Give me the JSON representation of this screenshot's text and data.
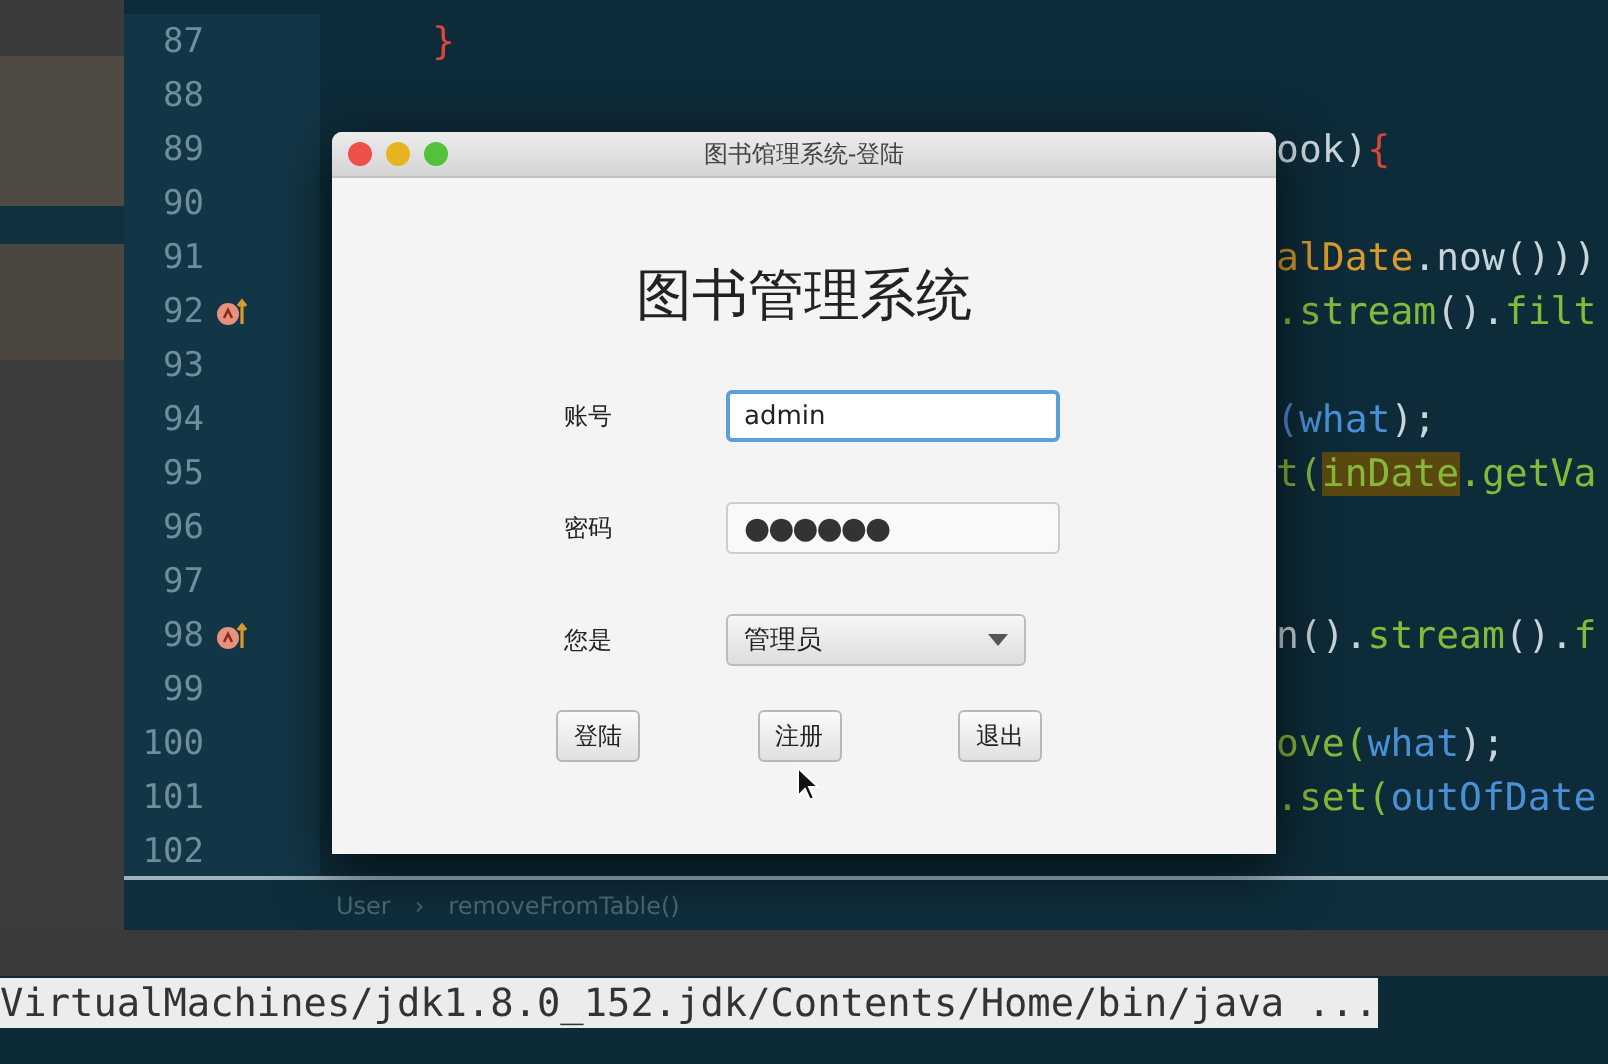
{
  "editor": {
    "lines": [
      {
        "number": "87",
        "marker": false,
        "kind": "full",
        "tokens": [
          {
            "text": "}",
            "color": "#d8463c",
            "highlighted": false
          }
        ]
      },
      {
        "number": "88",
        "marker": false,
        "kind": "tail"
      },
      {
        "number": "89",
        "marker": false,
        "kind": "tail",
        "tokens": [
          {
            "text": "ook)",
            "color": "#c9d4da",
            "highlighted": false
          },
          {
            "text": "{",
            "color": "#d8463c",
            "highlighted": false
          }
        ]
      },
      {
        "number": "90",
        "marker": false,
        "kind": "tail"
      },
      {
        "number": "91",
        "marker": false,
        "kind": "tail",
        "tokens": [
          {
            "text": "alDate",
            "color": "#d99b2b",
            "highlighted": false
          },
          {
            "text": ".now()))",
            "color": "#c9d4da",
            "highlighted": false
          }
        ]
      },
      {
        "number": "92",
        "marker": true,
        "kind": "tail",
        "tokens": [
          {
            "text": ".stream",
            "color": "#86b83a",
            "highlighted": false
          },
          {
            "text": "().",
            "color": "#c9d4da",
            "highlighted": false
          },
          {
            "text": "filt",
            "color": "#86b83a",
            "highlighted": false
          }
        ]
      },
      {
        "number": "93",
        "marker": false,
        "kind": "tail"
      },
      {
        "number": "94",
        "marker": false,
        "kind": "tail",
        "tokens": [
          {
            "text": "(what",
            "color": "#4b8fd6",
            "highlighted": false
          },
          {
            "text": ");",
            "color": "#c9d4da",
            "highlighted": false
          }
        ]
      },
      {
        "number": "95",
        "marker": false,
        "kind": "tail",
        "tokens": [
          {
            "text": "t(",
            "color": "#86b83a",
            "highlighted": false
          },
          {
            "text": "inDate",
            "highlighted": true
          },
          {
            "text": ".getVa",
            "color": "#86b83a",
            "highlighted": false
          }
        ]
      },
      {
        "number": "96",
        "marker": false,
        "kind": "tail"
      },
      {
        "number": "97",
        "marker": false,
        "kind": "tail"
      },
      {
        "number": "98",
        "marker": true,
        "kind": "tail",
        "tokens": [
          {
            "text": "n().",
            "color": "#c9d4da",
            "highlighted": false
          },
          {
            "text": "stream",
            "color": "#86b83a",
            "highlighted": false
          },
          {
            "text": "().",
            "color": "#c9d4da",
            "highlighted": false
          },
          {
            "text": "f",
            "color": "#86b83a",
            "highlighted": false
          }
        ]
      },
      {
        "number": "99",
        "marker": false,
        "kind": "tail"
      },
      {
        "number": "100",
        "marker": false,
        "kind": "tail",
        "tokens": [
          {
            "text": "ove(",
            "color": "#86b83a",
            "highlighted": false
          },
          {
            "text": "what",
            "color": "#4b8fd6",
            "highlighted": false
          },
          {
            "text": ");",
            "color": "#c9d4da",
            "highlighted": false
          }
        ]
      },
      {
        "number": "101",
        "marker": false,
        "kind": "tail",
        "tokens": [
          {
            "text": ".set(",
            "color": "#86b83a",
            "highlighted": false
          },
          {
            "text": "outOfDate",
            "color": "#4b8fd6",
            "highlighted": false
          }
        ]
      },
      {
        "number": "102",
        "marker": false,
        "kind": "tail"
      }
    ],
    "breadcrumb": {
      "items": [
        "User",
        "removeFromTable()"
      ],
      "separator": "›"
    }
  },
  "console": {
    "line": "VirtualMachines/jdk1.8.0_152.jdk/Contents/Home/bin/java ..."
  },
  "dialog": {
    "title": "图书馆理系统-登陆",
    "heading": "图书管理系统",
    "fields": [
      {
        "kind": "text",
        "label": "账号",
        "value": "admin",
        "focused": true
      },
      {
        "kind": "password",
        "label": "密码",
        "value": "●●●●●●",
        "focused": false
      },
      {
        "kind": "select",
        "label": "您是",
        "value": "管理员",
        "focused": false
      }
    ],
    "buttons": [
      "登陆",
      "注册",
      "退出"
    ]
  }
}
